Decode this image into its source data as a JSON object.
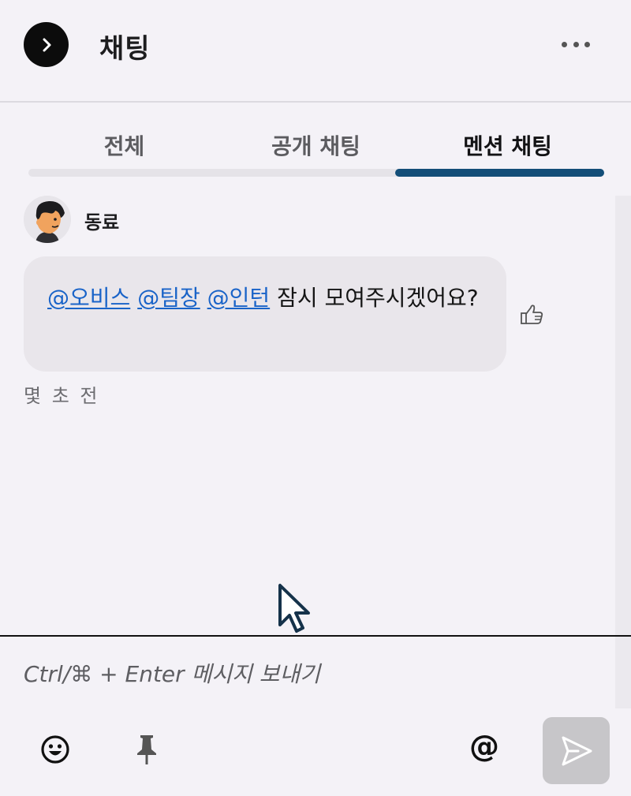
{
  "header": {
    "title": "채팅",
    "collapse_icon": "chevron-right-icon",
    "more_icon": "more-horizontal-icon"
  },
  "tabs": [
    {
      "label": "전체",
      "active": false
    },
    {
      "label": "공개 채팅",
      "active": false
    },
    {
      "label": "멘션 채팅",
      "active": true
    }
  ],
  "message": {
    "sender": "동료",
    "mentions": [
      "@오비스",
      "@팀장",
      "@인턴"
    ],
    "text": "잠시 모여주시겠어요?",
    "timestamp": "몇 초 전"
  },
  "composer": {
    "placeholder": "Ctrl/⌘ + Enter 메시지 보내기",
    "mention_label": "@"
  },
  "colors": {
    "accent": "#134e78",
    "mention_link": "#1963c8",
    "background": "#f4f2f7",
    "bubble": "#e9e6eb"
  }
}
